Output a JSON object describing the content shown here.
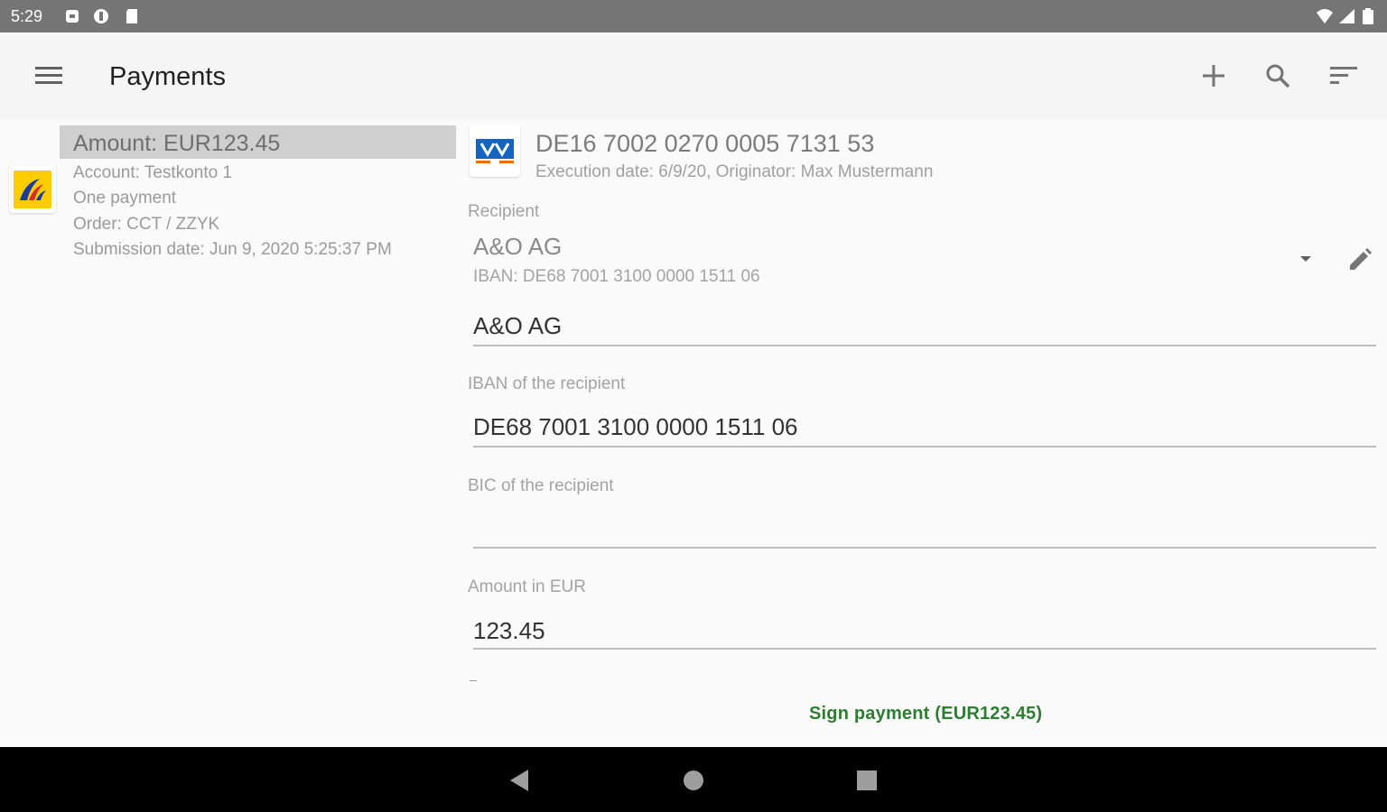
{
  "status_bar": {
    "time": "5:29"
  },
  "app_bar": {
    "title": "Payments"
  },
  "payment_item": {
    "amount": "Amount: EUR123.45",
    "account": "Account: Testkonto 1",
    "type": "One payment",
    "order": "Order: CCT / ZZYK",
    "submission": "Submission date: Jun 9, 2020 5:25:37 PM"
  },
  "detail": {
    "account_iban": "DE16 7002 0270 0005 7131 53",
    "execution_line": "Execution date: 6/9/20, Originator: Max Mustermann",
    "recipient_label": "Recipient",
    "recipient_name": "A&O AG",
    "recipient_iban": "IBAN: DE68 7001 3100 0000 1511 06",
    "name_field_value": "A&O AG",
    "iban_label": "IBAN of the recipient",
    "iban_field_value": "DE68 7001 3100 0000 1511 06",
    "bic_label": "BIC of the recipient",
    "bic_field_value": "",
    "amount_label": "Amount in EUR",
    "amount_field_value": "123.45",
    "sign_button": "Sign payment (EUR123.45)"
  },
  "colors": {
    "accent_green": "#2e7d32",
    "status_bar": "#757575",
    "nav_bar": "#000000"
  },
  "icons": [
    "menu-icon",
    "add-icon",
    "search-icon",
    "sort-icon",
    "dropdown-icon",
    "edit-icon",
    "back-icon",
    "home-icon",
    "recents-icon"
  ]
}
